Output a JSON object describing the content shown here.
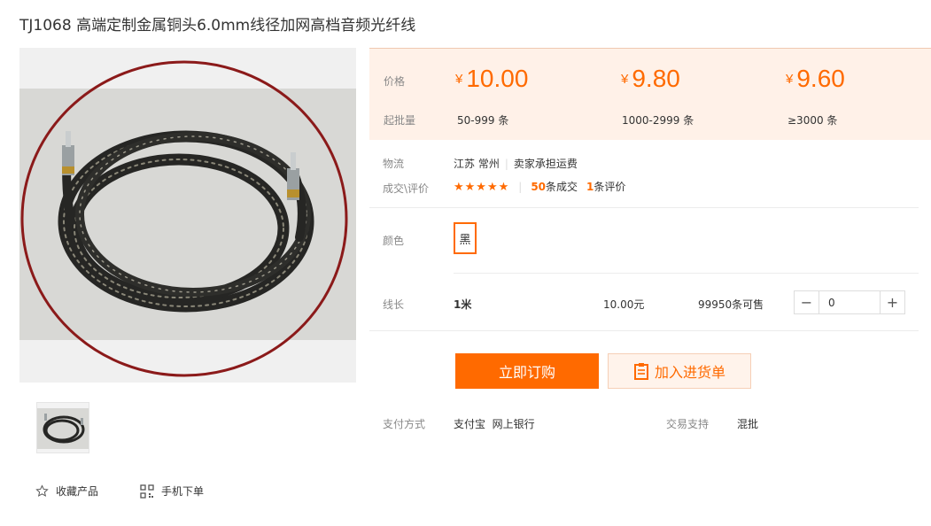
{
  "product": {
    "title": "TJ1068 高端定制金属铜头6.0mm线径加网高档音频光纤线"
  },
  "gallery": {
    "favorite_label": "收藏产品",
    "mobile_order_label": "手机下单"
  },
  "pricing": {
    "price_label": "价格",
    "moq_label": "起批量",
    "currency": "¥",
    "unit": "条",
    "tiers": [
      {
        "price": "10.00",
        "range": "50-999"
      },
      {
        "price": "9.80",
        "range": "1000-2999"
      },
      {
        "price": "9.60",
        "range": "≥3000"
      }
    ]
  },
  "logistics": {
    "label": "物流",
    "origin": "江苏 常州",
    "shipping": "卖家承担运费"
  },
  "reviews": {
    "label": "成交\\评价",
    "stars": "★★★★★",
    "deals_count": "50",
    "deals_suffix": "条成交",
    "review_count": "1",
    "review_suffix": "条评价"
  },
  "color": {
    "label": "颜色",
    "selected": "黑"
  },
  "sku": {
    "label": "线长",
    "name": "1米",
    "price": "10.00元",
    "stock": "99950条可售",
    "quantity": "0",
    "minus": "−",
    "plus": "+"
  },
  "actions": {
    "buy_now": "立即订购",
    "add_to_list": "加入进货单"
  },
  "payment": {
    "label": "支付方式",
    "methods": "支付宝  网上银行",
    "support_label": "交易支持",
    "support_value": "混批"
  },
  "colors": {
    "accent": "#ff6a00",
    "price_panel_bg": "#fff1e8"
  }
}
